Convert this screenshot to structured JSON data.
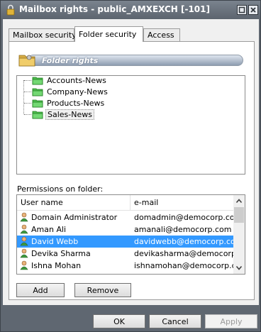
{
  "window": {
    "title": "Mailbox rights - public_AMXEXCH [-101]",
    "icon": "lock-icon"
  },
  "tabs": [
    {
      "label": "Mailbox security",
      "active": false
    },
    {
      "label": "Folder security",
      "active": true
    },
    {
      "label": "Access",
      "active": false
    }
  ],
  "folder_rights": {
    "header": "Folder rights",
    "icon": "folder-key-icon",
    "folders": [
      {
        "label": "Accounts-News",
        "selected": false
      },
      {
        "label": "Company-News",
        "selected": false
      },
      {
        "label": "Products-News",
        "selected": false
      },
      {
        "label": "Sales-News",
        "selected": true
      }
    ]
  },
  "permissions": {
    "label": "Permissions on folder:",
    "columns": [
      "User name",
      "e-mail"
    ],
    "rows": [
      {
        "name": "Domain Administrator",
        "email": "domadmin@democorp.com",
        "selected": false
      },
      {
        "name": "Aman Ali",
        "email": "amanali@democorp.com",
        "selected": false
      },
      {
        "name": "David Webb",
        "email": "davidwebb@democorp.com",
        "selected": true
      },
      {
        "name": "Devika Sharma",
        "email": "devikasharma@democorp.com",
        "selected": false
      },
      {
        "name": "Ishna Mohan",
        "email": "ishnamohan@democorp.com",
        "selected": false
      }
    ]
  },
  "actions": {
    "add": "Add",
    "remove": "Remove"
  },
  "footer": {
    "ok": "OK",
    "cancel": "Cancel",
    "apply": "Apply"
  },
  "colors": {
    "titlebar": "#5f6771",
    "selection": "#3399ff",
    "folder": "#2e9e2e"
  }
}
